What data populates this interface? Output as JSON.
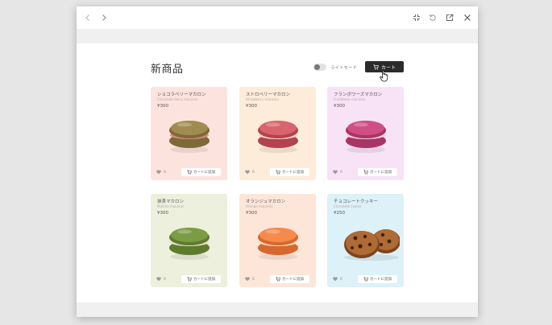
{
  "page": {
    "title": "新商品",
    "theme_toggle_label": "ライトモード",
    "cart_button_label": "カート"
  },
  "products": [
    {
      "name": "ショコラベリーマカロン",
      "subtitle": "Chocolate berry macaron",
      "price": "¥300",
      "likes": "0",
      "add_label": "カートに追加",
      "bg": "#fde3de",
      "art": "macaron",
      "colors": {
        "shell": "#a08c50",
        "shell_dark": "#7d6a38",
        "filling": "#d98a86"
      }
    },
    {
      "name": "ストロベリーマカロン",
      "subtitle": "Strawberry macaron",
      "price": "¥300",
      "likes": "0",
      "add_label": "カートに追加",
      "bg": "#fcecd9",
      "art": "macaron",
      "colors": {
        "shell": "#d9646e",
        "shell_dark": "#b2434f",
        "filling": "#f5d6c8"
      }
    },
    {
      "name": "フランボワーズマカロン",
      "subtitle": "Framboise macaron",
      "price": "¥300",
      "likes": "0",
      "add_label": "カートに追加",
      "bg": "#f7e2f6",
      "art": "macaron",
      "colors": {
        "shell": "#cf4f84",
        "shell_dark": "#a83565",
        "filling": "#f2d2d8"
      }
    },
    {
      "name": "抹茶マカロン",
      "subtitle": "Matcha macaron",
      "price": "¥300",
      "likes": "0",
      "add_label": "カートに追加",
      "bg": "#ecf0dc",
      "art": "macaron",
      "colors": {
        "shell": "#7b9c44",
        "shell_dark": "#5d7c2e",
        "filling": "#efd9c8"
      }
    },
    {
      "name": "オランジュマカロン",
      "subtitle": "Orange macaron",
      "price": "¥300",
      "likes": "0",
      "add_label": "カートに追加",
      "bg": "#fde6d8",
      "art": "macaron",
      "colors": {
        "shell": "#f58a4c",
        "shell_dark": "#d6692e",
        "filling": "#fbd7bd"
      }
    },
    {
      "name": "チョコレートクッキー",
      "subtitle": "Chocolate cookie",
      "price": "¥250",
      "likes": "0",
      "add_label": "カートに追加",
      "bg": "#dcf1f8",
      "art": "cookie",
      "colors": {
        "shell": "#b06a34",
        "shell_dark": "#7d451e",
        "filling": "#3d2212"
      }
    }
  ],
  "colors": {
    "text": "#333333",
    "cart_button_bg": "#2b2b2b",
    "window_gray": "#f0f0f0"
  },
  "icons": {
    "nav": [
      "chevron-left-icon",
      "chevron-right-icon"
    ],
    "window_actions": [
      "fullscreen-icon",
      "refresh-icon",
      "open-external-icon",
      "close-icon"
    ],
    "card": [
      "heart-icon",
      "cart-icon"
    ]
  }
}
